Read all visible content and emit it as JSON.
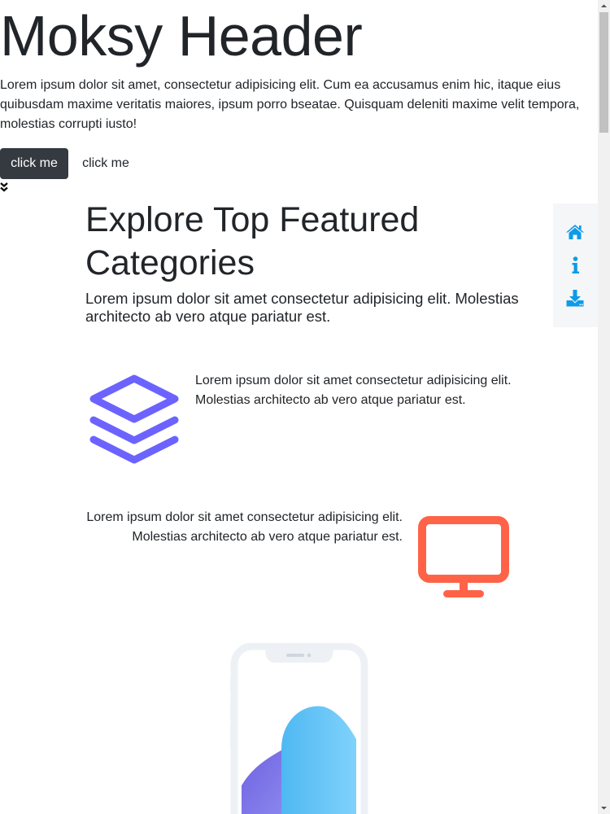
{
  "hero": {
    "title": "Moksy Header",
    "text": "Lorem ipsum dolor sit amet, consectetur adipisicing elit. Cum ea accusamus enim hic, itaque eius quibusdam maxime veritatis maiores, ipsum porro bseatae. Quisquam deleniti maxime velit tempora, molestias corrupti iusto!",
    "primary_button": "click me",
    "secondary_button": "click me",
    "scroll_hint_icon": "double-chevron-down-icon"
  },
  "features": {
    "title": "Explore Top Featured Categories",
    "subtitle": "Lorem ipsum dolor sit amet consectetur adipisicing elit. Molestias architecto ab vero atque pariatur est.",
    "items": [
      {
        "icon": "layers-icon",
        "icon_color": "#6c63ff",
        "text": "Lorem ipsum dolor sit amet consectetur adipisicing elit. Molestias architecto ab vero atque pariatur est."
      },
      {
        "icon": "monitor-icon",
        "icon_color": "#ff6347",
        "text": "Lorem ipsum dolor sit amet consectetur adipisicing elit. Molestias architecto ab vero atque pariatur est."
      }
    ],
    "illustration": "phone-illustration"
  },
  "side_nav": {
    "items": [
      {
        "icon": "home-icon"
      },
      {
        "icon": "info-icon"
      },
      {
        "icon": "download-icon"
      }
    ],
    "icon_color": "#0d9be8"
  }
}
